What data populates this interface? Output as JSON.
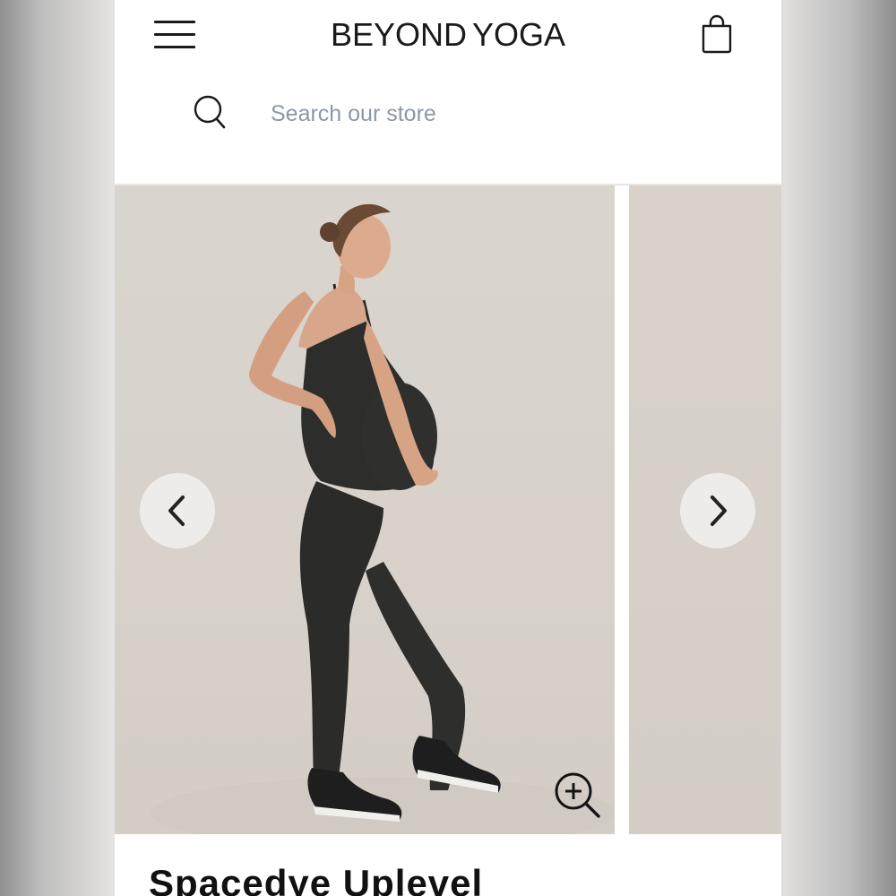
{
  "header": {
    "logo_primary": "BEYOND",
    "logo_secondary": "YOGA",
    "menu_icon": "hamburger-menu-icon",
    "cart_icon": "shopping-bag-icon"
  },
  "search": {
    "placeholder": "Search our store",
    "icon": "search-icon"
  },
  "gallery": {
    "prev_icon": "chevron-left-icon",
    "next_icon": "chevron-right-icon",
    "zoom_icon": "zoom-in-icon",
    "image_alt": "Model wearing dark heather maternity jumpsuit"
  },
  "product": {
    "title": "Spacedye Uplevel"
  },
  "colors": {
    "text": "#1a1a1a",
    "placeholder": "#8d97a6",
    "photo_backdrop": "#d9d4cd",
    "garment": "#2e2e2c"
  }
}
